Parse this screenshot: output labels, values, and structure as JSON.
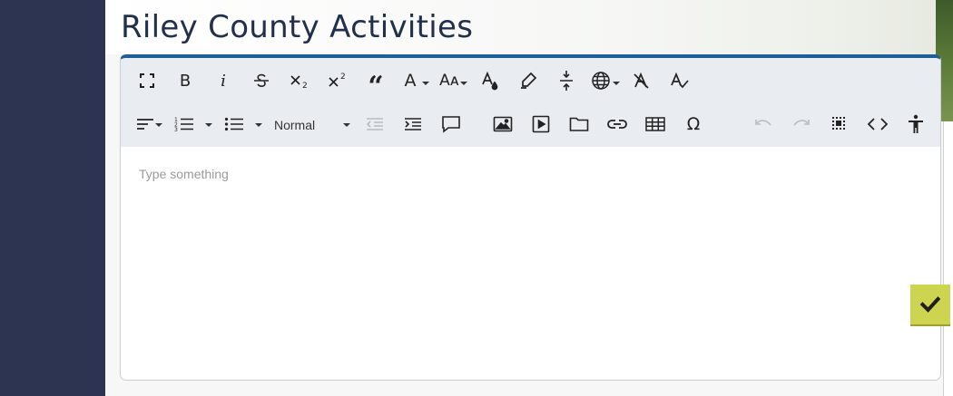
{
  "page": {
    "title": "Riley County Activities"
  },
  "editor": {
    "placeholder": "Type something",
    "format_select": {
      "selected": "Normal"
    },
    "toolbar_row1": [
      {
        "name": "fullsize-icon"
      },
      {
        "name": "bold-button",
        "glyph": "B"
      },
      {
        "name": "italic-button",
        "glyph": "i"
      },
      {
        "name": "strikethrough-icon"
      },
      {
        "name": "subscript-icon"
      },
      {
        "name": "superscript-icon"
      },
      {
        "name": "blockquote-icon",
        "glyph": "“"
      },
      {
        "name": "font-family-icon",
        "glyph": "A"
      },
      {
        "name": "font-size-icon",
        "glyph": "Aᴀ"
      },
      {
        "name": "text-color-icon"
      },
      {
        "name": "highlight-icon"
      },
      {
        "name": "line-height-icon"
      },
      {
        "name": "language-icon"
      },
      {
        "name": "clear-formatting-icon"
      },
      {
        "name": "spellcheck-icon"
      }
    ],
    "toolbar_row2": [
      {
        "name": "align-icon"
      },
      {
        "name": "ordered-list-icon"
      },
      {
        "name": "unordered-list-icon"
      },
      {
        "name": "outdent-icon",
        "disabled": true
      },
      {
        "name": "indent-icon"
      },
      {
        "name": "comment-icon"
      },
      {
        "name": "image-icon"
      },
      {
        "name": "video-icon"
      },
      {
        "name": "file-icon"
      },
      {
        "name": "link-icon"
      },
      {
        "name": "table-icon"
      },
      {
        "name": "special-character-icon",
        "glyph": "Ω"
      },
      {
        "name": "undo-icon",
        "disabled": true
      },
      {
        "name": "redo-icon",
        "disabled": true
      },
      {
        "name": "select-all-icon"
      },
      {
        "name": "source-code-icon"
      },
      {
        "name": "accessibility-icon"
      }
    ]
  },
  "confirm_button": {
    "icon": "checkmark-icon"
  },
  "colors": {
    "sidebar": "#2d3451",
    "title": "#22304d",
    "editor_border_top": "#1d5f96",
    "toolbar_bg": "#e9edf1",
    "confirm_bg": "#cdd44f"
  }
}
